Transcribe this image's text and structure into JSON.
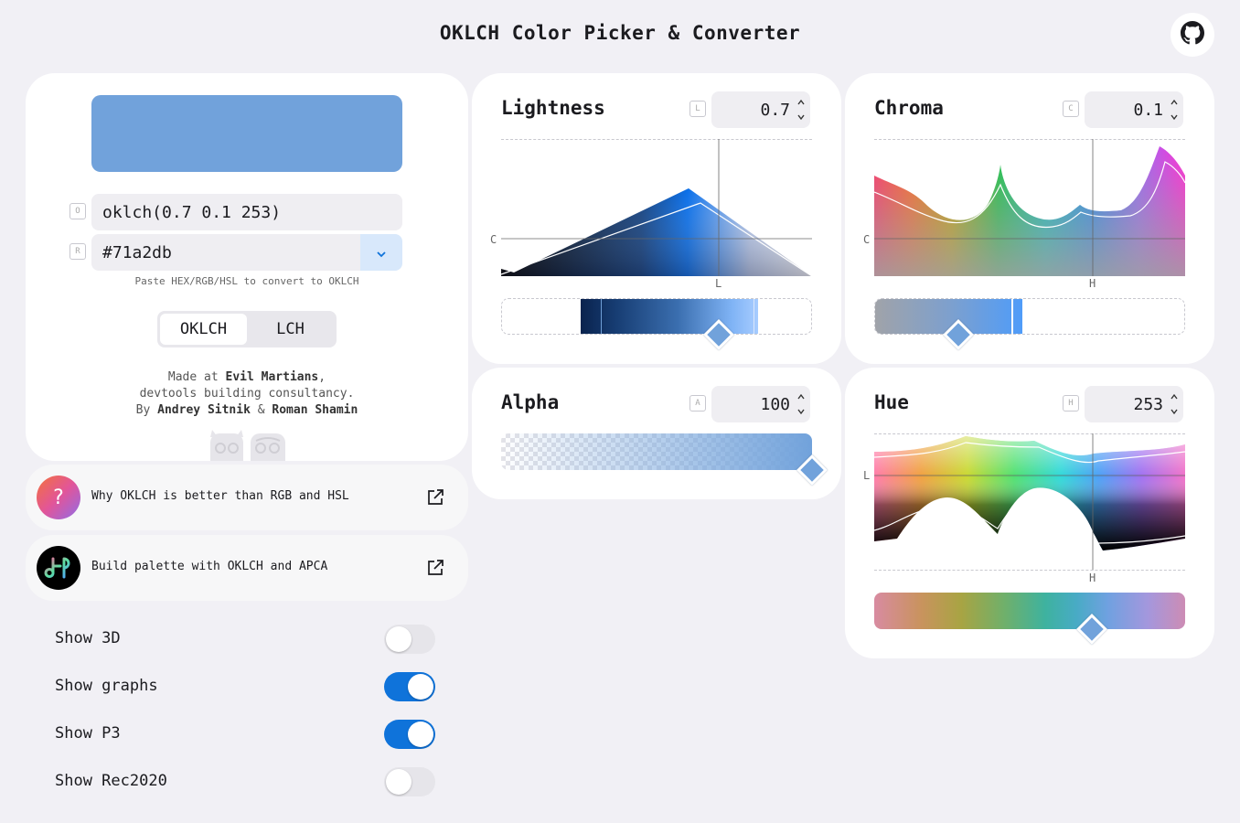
{
  "page": {
    "title": "OKLCH Color Picker & Converter"
  },
  "color": {
    "hex_value": "#71a2db"
  },
  "picker": {
    "oklch_tag": "O",
    "rgb_tag": "R",
    "oklch_value": "oklch(0.7 0.1 253)",
    "hex_value": "#71a2db",
    "hint": "Paste HEX/RGB/HSL to convert to OKLCH",
    "modes": [
      "OKLCH",
      "LCH"
    ],
    "active_mode": "OKLCH"
  },
  "credits": {
    "made_at": "Made at ",
    "company": "Evil Martians",
    "comma": ",",
    "line2": "devtools building consultancy.",
    "by": "By ",
    "author1": "Andrey Sitnik",
    "amp": " & ",
    "author2": "Roman Shamin"
  },
  "links": [
    {
      "label": "Why OKLCH is better than RGB and HSL",
      "icon_glyph": "?"
    },
    {
      "label": "Build palette with OKLCH and APCA"
    }
  ],
  "toggles": [
    {
      "label": "Show 3D",
      "on": false
    },
    {
      "label": "Show graphs",
      "on": true
    },
    {
      "label": "Show P3",
      "on": true
    },
    {
      "label": "Show Rec2020",
      "on": false
    }
  ],
  "channels": {
    "lightness": {
      "title": "Lightness",
      "tag": "L",
      "value": "0.7",
      "axis_y": "C",
      "axis_x": "L",
      "position": 0.7
    },
    "chroma": {
      "title": "Chroma",
      "tag": "C",
      "value": "0.1",
      "axis_y": "C",
      "axis_x": "H",
      "position": 0.27
    },
    "alpha": {
      "title": "Alpha",
      "tag": "A",
      "value": "100",
      "position": 1.0
    },
    "hue": {
      "title": "Hue",
      "tag": "H",
      "value": "253",
      "axis_y": "L",
      "axis_x": "H",
      "position": 0.7
    }
  }
}
